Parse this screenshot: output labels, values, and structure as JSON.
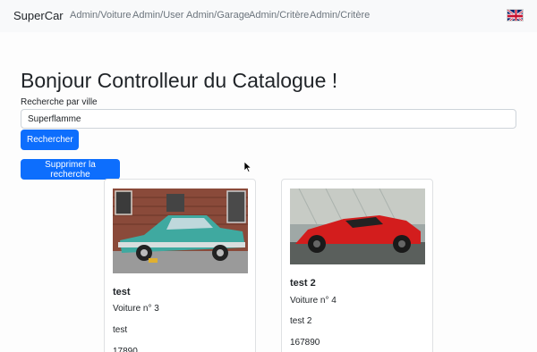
{
  "navbar": {
    "brand": "SuperCar",
    "links": [
      "Admin/Voiture",
      "Admin/User",
      "Admin/Garage",
      "Admin/Critère",
      "Admin/Critère"
    ],
    "language_icon": "uk-flag-icon"
  },
  "main": {
    "title": "Bonjour Controlleur du Catalogue !",
    "search_label": "Recherche par ville",
    "search_value": "Superflamme",
    "search_button": "Rechercher",
    "clear_button": "Supprimer la recherche"
  },
  "cards": [
    {
      "title": "test",
      "number": "Voiture n° 3",
      "description": "test",
      "price": "17890",
      "image": "teal-vintage-car-photo"
    },
    {
      "title": "test 2",
      "number": "Voiture n° 4",
      "description": "test 2",
      "price": "167890",
      "image": "red-sports-car-photo"
    }
  ],
  "colors": {
    "primary": "#0d6efd",
    "navbar_bg": "#f8f9fa",
    "text": "#212529",
    "muted": "#6c757d"
  }
}
